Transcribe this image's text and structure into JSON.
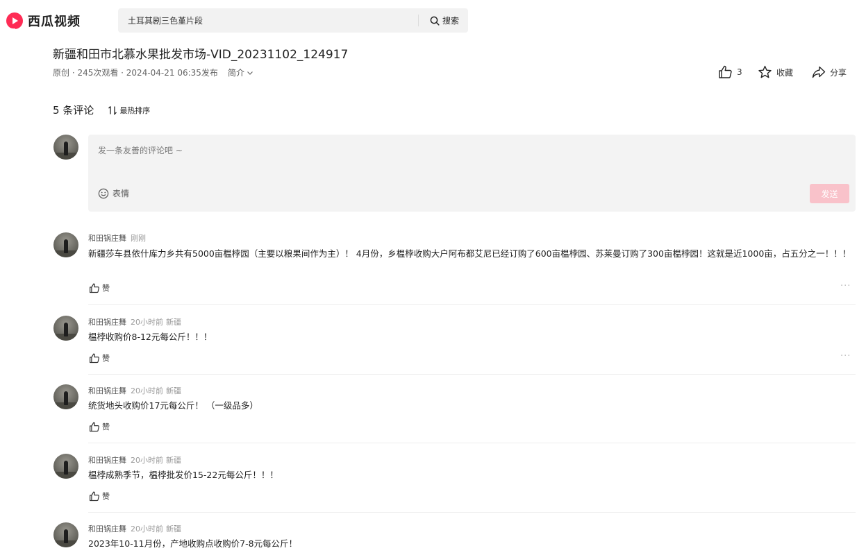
{
  "brand": {
    "name": "西瓜视频",
    "accent": "#fe2c55"
  },
  "search": {
    "value": "土耳其剧三色堇片段",
    "button_label": "搜索"
  },
  "video": {
    "title": "新疆和田市北慕水果批发市场-VID_20231102_124917",
    "meta": "原创 · 245次观看 · 2024-04-21 06:35发布",
    "desc_label": "简介"
  },
  "actions": {
    "like_count": "3",
    "favorite_label": "收藏",
    "share_label": "分享"
  },
  "comments_section": {
    "count_label": "5 条评论",
    "sort_label": "最热排序",
    "compose_placeholder": "发一条友善的评论吧 ~",
    "emoji_label": "表情",
    "send_label": "发送"
  },
  "like_label": "赞",
  "more_label": "···",
  "comments": [
    {
      "user": "和田锅庄舞",
      "time": "刚刚",
      "location": "",
      "text": "新疆莎车县依什库力乡共有5000亩榅桲园（主要以粮果间作为主）！ 4月份，乡榅桲收购大户阿布都艾尼已经订购了600亩榅桲园、苏莱曼订购了300亩榅桲园！这就是近1000亩，占五分之一！！！"
    },
    {
      "user": "和田锅庄舞",
      "time": "20小时前",
      "location": "新疆",
      "text": "榅桲收购价8-12元每公斤！！！"
    },
    {
      "user": "和田锅庄舞",
      "time": "20小时前",
      "location": "新疆",
      "text": "统货地头收购价17元每公斤！ （一级品多）"
    },
    {
      "user": "和田锅庄舞",
      "time": "20小时前",
      "location": "新疆",
      "text": "榅桲成熟季节，榅桲批发价15-22元每公斤！！！"
    },
    {
      "user": "和田锅庄舞",
      "time": "20小时前",
      "location": "新疆",
      "text": "2023年10-11月份，产地收购点收购价7-8元每公斤！"
    }
  ]
}
